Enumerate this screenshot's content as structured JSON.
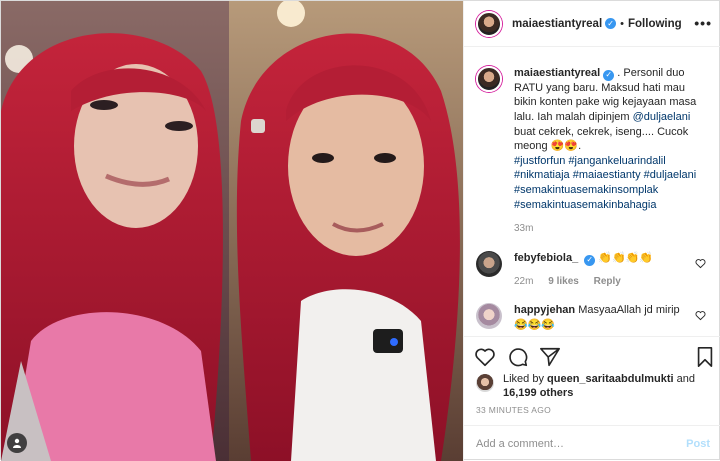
{
  "photo": {
    "alt": ""
  },
  "header": {
    "username": "maiaestiantyreal",
    "separator": "•",
    "follow_label": "Following",
    "more_label": "•••"
  },
  "caption": {
    "username": "maiaestiantyreal",
    "lead": " . Personil duo RATU yang baru. Maksud hati mau bikin konten pake wig kejayaan masa lalu. Iah malah dipinjem ",
    "mention": "@duljaelani",
    "mid": " buat cekrek, cekrek, iseng.... Cucok meong ",
    "emoji": "😍😍",
    "end": ".",
    "hashtags": [
      "#justforfun",
      "#jangankeluarindalil",
      "#nikmatiaja",
      "#maiaestianty",
      "#duljaelani",
      "#semakintuasemakinsomplak",
      "#semakintuasemakinbahagia"
    ],
    "time": "33m"
  },
  "comments": [
    {
      "username": "febyfebiola_",
      "verified": true,
      "text": "👏👏👏👏",
      "time": "22m",
      "likes": "9 likes",
      "reply": "Reply"
    },
    {
      "username": "happyjehan",
      "verified": false,
      "text": "MasyaaAllah jd mirip 😂😂😂",
      "time": "",
      "likes": "",
      "reply": ""
    }
  ],
  "likes": {
    "prefix": "Liked by ",
    "user": "queen_saritaabdulmukti",
    "mid": " and",
    "others": "16,199 others"
  },
  "timestamp": "33 MINUTES AGO",
  "add_comment": {
    "placeholder": "Add a comment…",
    "post_label": "Post"
  },
  "colors": {
    "link": "#00376b",
    "verified": "#3897f0",
    "post_disabled": "#b2dffc",
    "muted": "#8e8e8e"
  }
}
